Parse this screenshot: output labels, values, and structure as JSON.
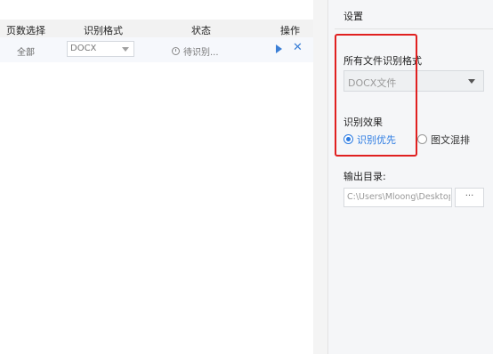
{
  "list": {
    "headers": {
      "page_select": "页数选择",
      "format": "识别格式",
      "status": "状态",
      "action": "操作"
    },
    "rows": [
      {
        "page_range": "全部",
        "format": "DOCX",
        "status": "待识别...",
        "icons": [
          "play-icon",
          "close-icon"
        ]
      }
    ]
  },
  "settings": {
    "title": "设置",
    "all_format_label": "所有文件识别格式",
    "all_format_value": "DOCX文件",
    "effect_label": "识别效果",
    "effect_options": [
      {
        "label": "识别优先",
        "selected": true
      },
      {
        "label": "图文混排",
        "selected": false
      }
    ],
    "output_label": "输出目录:",
    "output_path": "C:\\Users\\Mloong\\Desktop\\",
    "browse_label": "···"
  },
  "colors": {
    "accent": "#2a7ae2",
    "highlight": "#e02020"
  }
}
